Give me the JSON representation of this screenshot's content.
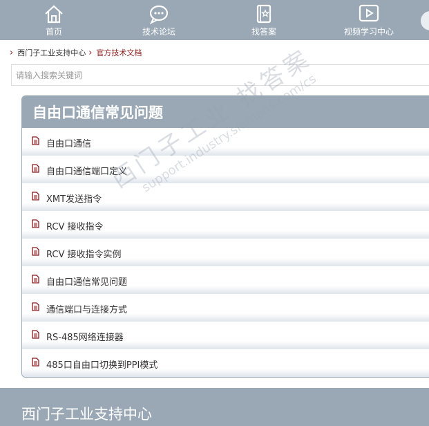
{
  "nav": {
    "items": [
      {
        "label": "首页",
        "icon": "home-icon"
      },
      {
        "label": "技术论坛",
        "icon": "chat-icon"
      },
      {
        "label": "找答案",
        "icon": "book-icon"
      },
      {
        "label": "视频学习中心",
        "icon": "video-icon"
      }
    ]
  },
  "breadcrumb": {
    "home": "西门子工业支持中心",
    "current": "官方技术文档"
  },
  "search": {
    "placeholder": "请输入搜索关键词"
  },
  "panel": {
    "title": "自由口通信常见问题",
    "items": [
      {
        "label": "自由口通信"
      },
      {
        "label": "自由口通信端口定义"
      },
      {
        "label": "XMT发送指令"
      },
      {
        "label": " RCV 接收指令"
      },
      {
        "label": "RCV 接收指令实例"
      },
      {
        "label": "自由口通信常见问题"
      },
      {
        "label": "通信端口与连接方式"
      },
      {
        "label": " RS-485网络连接器"
      },
      {
        "label": " 485口自由口切换到PPI模式"
      }
    ]
  },
  "watermark": {
    "line1": "西门子工业 找答案",
    "line2": "support.industry.siemens.com/cs"
  },
  "footer": {
    "title": "西门子工业支持中心"
  },
  "colors": {
    "nav_bg": "#9aa8b5",
    "accent": "#8b1a1a"
  }
}
